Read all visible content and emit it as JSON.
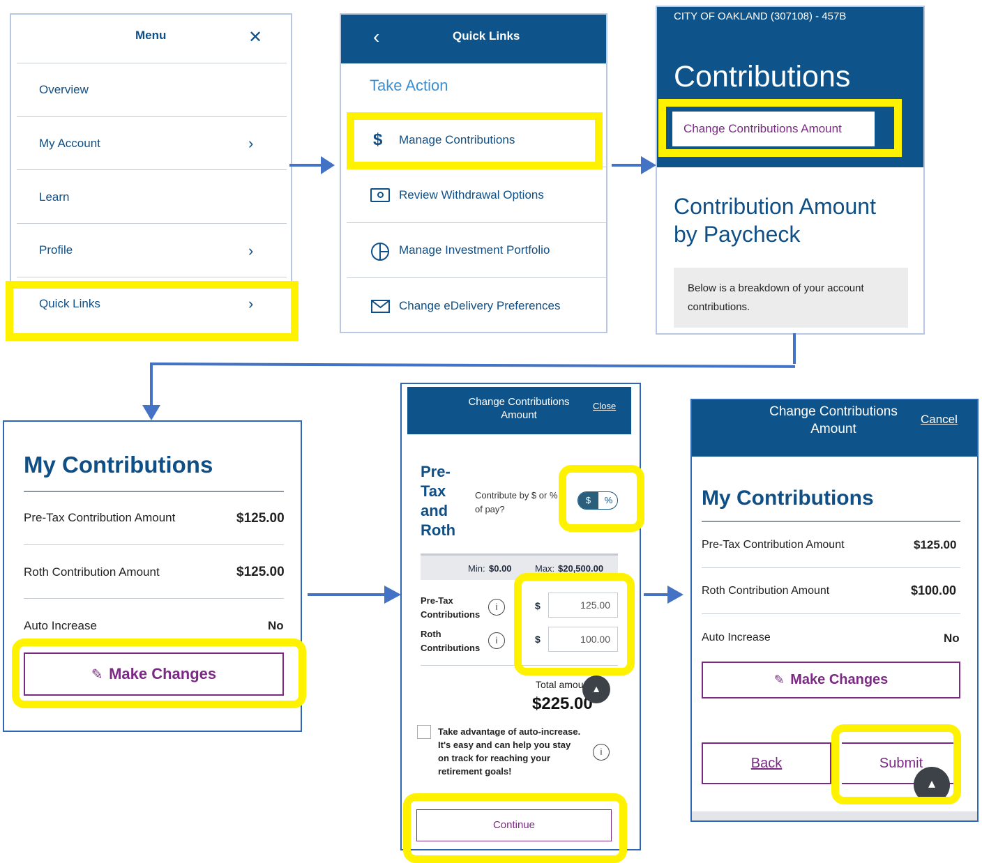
{
  "menu": {
    "title": "Menu",
    "items": [
      {
        "label": "Overview"
      },
      {
        "label": "My Account"
      },
      {
        "label": "Learn"
      },
      {
        "label": "Profile"
      },
      {
        "label": "Quick Links"
      }
    ]
  },
  "quick_links": {
    "title": "Quick Links",
    "section": "Take Action",
    "items": [
      {
        "label": "Manage Contributions",
        "icon": "dollar-icon"
      },
      {
        "label": "Review Withdrawal Options",
        "icon": "cash-icon"
      },
      {
        "label": "Manage Investment Portfolio",
        "icon": "pie-chart-icon"
      },
      {
        "label": "Change eDelivery Preferences",
        "icon": "envelope-icon"
      }
    ]
  },
  "contributions_page": {
    "plan": "CITY OF OAKLAND (307108) - 457B",
    "title": "Contributions",
    "change_link": "Change Contributions Amount",
    "subtitle_line1": "Contribution Amount",
    "subtitle_line2": "by Paycheck",
    "info": "Below is a breakdown of your account contributions."
  },
  "my_contributions_1": {
    "title": "My Contributions",
    "rows": [
      {
        "label": "Pre-Tax Contribution Amount",
        "value": "$125.00"
      },
      {
        "label": "Roth Contribution Amount",
        "value": "$125.00"
      },
      {
        "label": "Auto Increase",
        "value": "No"
      }
    ],
    "make_changes": "Make Changes"
  },
  "change_form": {
    "header": "Change Contributions Amount",
    "close": "Close",
    "heading_words": [
      "Pre-",
      "Tax",
      "and",
      "Roth"
    ],
    "contribute_by": "Contribute by $ or % of pay?",
    "toggle_dollar": "$",
    "toggle_percent": "%",
    "min_label": "Min:",
    "min_value": "$0.00",
    "max_label": "Max:",
    "max_value": "$20,500.00",
    "pretax_label_1": "Pre-Tax",
    "pretax_label_2": "Contributions",
    "roth_label_1": "Roth",
    "roth_label_2": "Contributions",
    "currency": "$",
    "pretax_value": "125.00",
    "roth_value": "100.00",
    "total_label": "Total amou",
    "total_value": "$225.00",
    "auto_increase_text": "Take advantage of auto-increase. It's easy and can help you stay on track for reaching your retirement goals!",
    "continue": "Continue"
  },
  "my_contributions_2": {
    "header": "Change Contributions Amount",
    "cancel": "Cancel",
    "title": "My Contributions",
    "rows": [
      {
        "label": "Pre-Tax Contribution Amount",
        "value": "$125.00"
      },
      {
        "label": "Roth Contribution Amount",
        "value": "$100.00"
      },
      {
        "label": "Auto Increase",
        "value": "No"
      }
    ],
    "make_changes": "Make Changes",
    "back": "Back",
    "submit": "Submit"
  },
  "colors": {
    "navy": "#0e5389",
    "highlight": "#fff200",
    "purple": "#7b2a84",
    "arrow": "#4472c4"
  }
}
